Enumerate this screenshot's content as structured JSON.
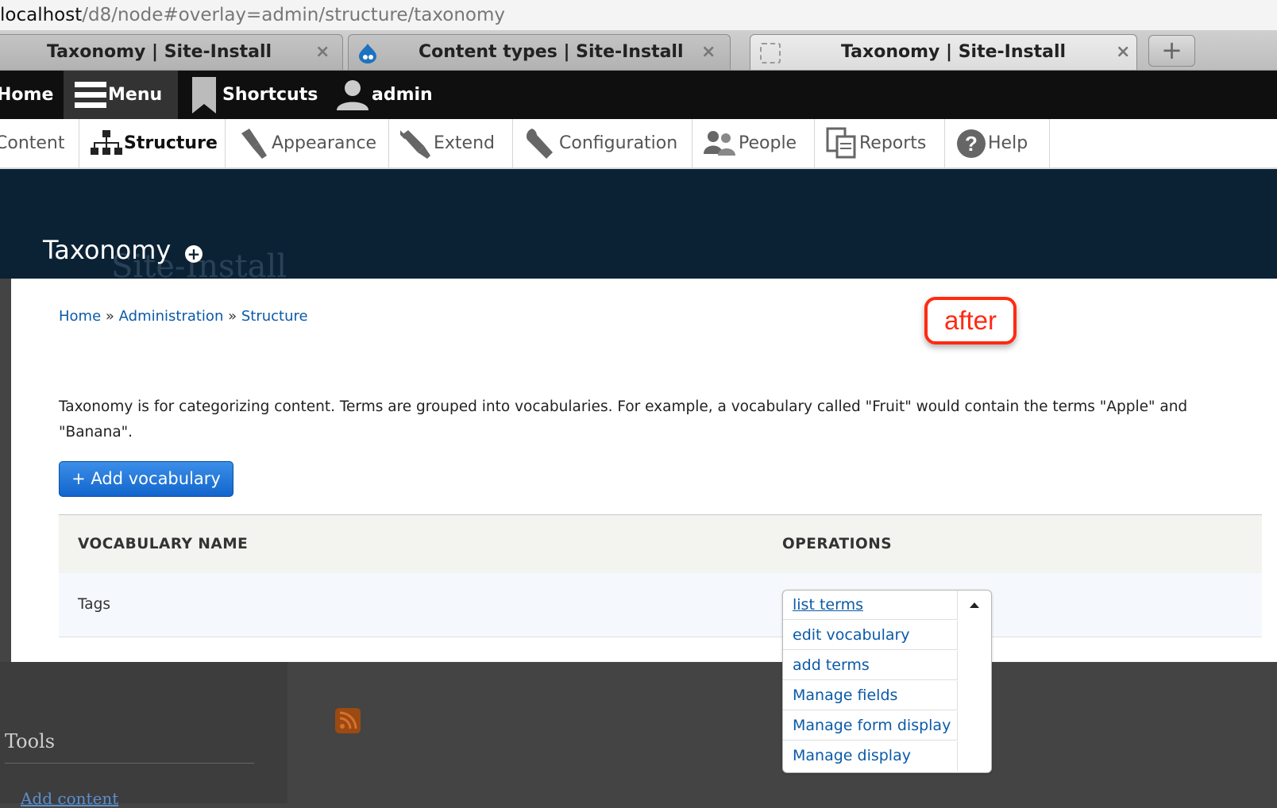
{
  "browser": {
    "url_host": "localhost",
    "url_path": "/d8/node#overlay=admin/structure/taxonomy",
    "tabs": [
      {
        "title": "Taxonomy | Site-Install",
        "close": "×"
      },
      {
        "title": "Content types | Site-Install",
        "close": "×"
      },
      {
        "title": "Taxonomy | Site-Install",
        "close": "×"
      }
    ],
    "new_tab": "+"
  },
  "toolbar": {
    "home": "Home",
    "menu": "Menu",
    "shortcuts": "Shortcuts",
    "user": "admin"
  },
  "tray": {
    "items": [
      {
        "label": "Content",
        "icon": "content-icon"
      },
      {
        "label": "Structure",
        "icon": "sitemap-icon"
      },
      {
        "label": "Appearance",
        "icon": "paintbrush-icon"
      },
      {
        "label": "Extend",
        "icon": "plug-icon"
      },
      {
        "label": "Configuration",
        "icon": "wrench-icon"
      },
      {
        "label": "People",
        "icon": "people-icon"
      },
      {
        "label": "Reports",
        "icon": "reports-icon"
      },
      {
        "label": "Help",
        "icon": "help-icon"
      }
    ]
  },
  "header": {
    "title": "Taxonomy",
    "ghost_site_name": "Site-Install"
  },
  "breadcrumb": {
    "items": [
      "Home",
      "Administration",
      "Structure"
    ],
    "separator": "»"
  },
  "annotation": {
    "label": "after"
  },
  "main": {
    "help_text": "Taxonomy is for categorizing content. Terms are grouped into vocabularies. For example, a vocabulary called \"Fruit\" would contain the terms \"Apple\" and \"Banana\".",
    "add_button": "+ Add vocabulary"
  },
  "table": {
    "headers": [
      "VOCABULARY NAME",
      "OPERATIONS"
    ],
    "rows": [
      {
        "name": "Tags"
      }
    ]
  },
  "operations": {
    "items": [
      "list terms",
      "edit vocabulary",
      "add terms",
      "Manage fields",
      "Manage form display",
      "Manage display"
    ]
  },
  "sidebar": {
    "heading": "Tools",
    "link": "Add content"
  },
  "colors": {
    "toolbar_bg": "#0f0f0f",
    "header_bg": "#0b2235",
    "link": "#0b5aa8",
    "button_blue": "#1266cc",
    "annotation_red": "#ff2a12"
  }
}
